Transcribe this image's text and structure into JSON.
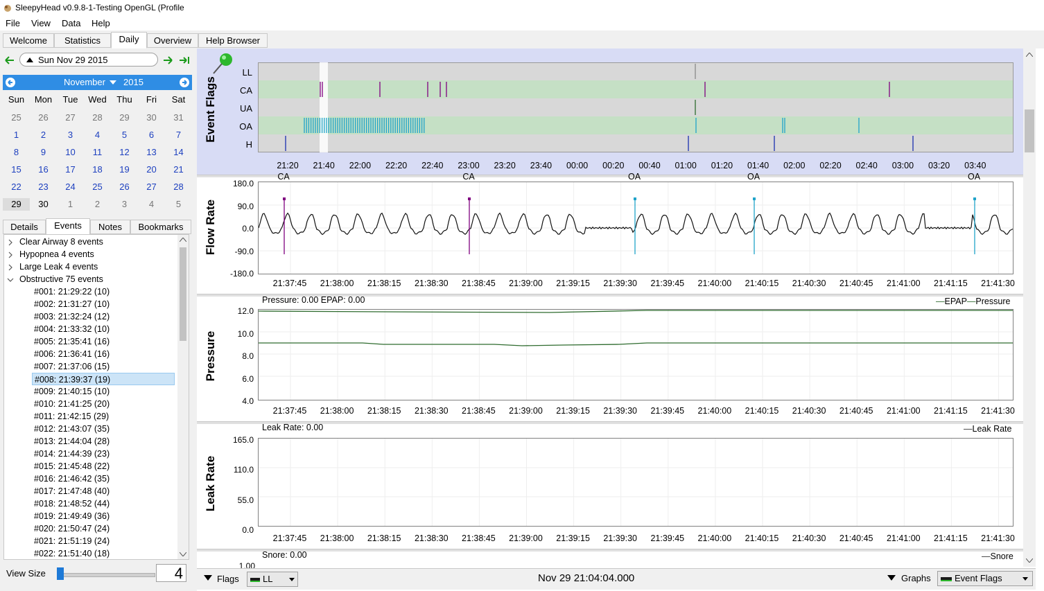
{
  "window": {
    "title": "SleepyHead v0.9.8-1-Testing OpenGL (Profile"
  },
  "menu": [
    "File",
    "View",
    "Data",
    "Help"
  ],
  "tabs": [
    {
      "label": "Welcome"
    },
    {
      "label": "Statistics"
    },
    {
      "label": "Daily"
    },
    {
      "label": "Overview"
    },
    {
      "label": "Help Browser"
    }
  ],
  "date_nav": {
    "current_date": "Sun Nov 29 2015"
  },
  "calendar": {
    "month": "November",
    "year": "2015",
    "weekdays": [
      "Sun",
      "Mon",
      "Tue",
      "Wed",
      "Thu",
      "Fri",
      "Sat"
    ],
    "weeks": [
      [
        "25",
        "26",
        "27",
        "28",
        "29",
        "30",
        "31"
      ],
      [
        "1",
        "2",
        "3",
        "4",
        "5",
        "6",
        "7"
      ],
      [
        "8",
        "9",
        "10",
        "11",
        "12",
        "13",
        "14"
      ],
      [
        "15",
        "16",
        "17",
        "18",
        "19",
        "20",
        "21"
      ],
      [
        "22",
        "23",
        "24",
        "25",
        "26",
        "27",
        "28"
      ],
      [
        "29",
        "30",
        "1",
        "2",
        "3",
        "4",
        "5"
      ]
    ],
    "selected": "29"
  },
  "left_tabs": [
    "Details",
    "Events",
    "Notes",
    "Bookmarks"
  ],
  "event_tree": {
    "groups": [
      "Clear Airway 8 events",
      "Hypopnea 4 events",
      "Large Leak 4 events",
      "Obstructive 75 events"
    ],
    "items": [
      "#001: 21:29:22 (10)",
      "#002: 21:31:27 (10)",
      "#003: 21:32:24 (12)",
      "#004: 21:33:32 (10)",
      "#005: 21:35:41 (16)",
      "#006: 21:36:41 (16)",
      "#007: 21:37:06 (15)",
      "#008: 21:39:37 (19)",
      "#009: 21:40:15 (10)",
      "#010: 21:41:25 (20)",
      "#011: 21:42:15 (29)",
      "#012: 21:43:07 (35)",
      "#013: 21:44:04 (28)",
      "#014: 21:44:39 (23)",
      "#015: 21:45:48 (22)",
      "#016: 21:46:42 (35)",
      "#017: 21:47:48 (40)",
      "#018: 21:48:52 (44)",
      "#019: 21:49:49 (36)",
      "#020: 21:50:47 (24)",
      "#021: 21:51:19 (24)",
      "#022: 21:51:40 (18)"
    ],
    "selected_index": 7
  },
  "view_size": {
    "label": "View Size",
    "value": "4"
  },
  "event_flags": {
    "title": "Event Flags",
    "rows": [
      "LL",
      "CA",
      "UA",
      "OA",
      "H"
    ],
    "time_ticks": [
      "21:20",
      "21:40",
      "22:00",
      "22:20",
      "22:40",
      "23:00",
      "23:20",
      "23:40",
      "00:00",
      "00:20",
      "00:40",
      "01:00",
      "01:20",
      "01:40",
      "02:00",
      "02:20",
      "02:40",
      "03:00",
      "03:20",
      "03:40"
    ]
  },
  "flow_rate": {
    "title": "Flow Rate",
    "yticks": [
      "180.0",
      "90.0",
      "0.0",
      "-90.0",
      "-180.0"
    ],
    "events": [
      {
        "label": "CA"
      },
      {
        "label": "CA"
      },
      {
        "label": "OA"
      },
      {
        "label": "OA"
      },
      {
        "label": "OA"
      }
    ],
    "xticks": [
      "21:37:45",
      "21:38:00",
      "21:38:15",
      "21:38:30",
      "21:38:45",
      "21:39:00",
      "21:39:15",
      "21:39:30",
      "21:39:45",
      "21:40:00",
      "21:40:15",
      "21:40:30",
      "21:40:45",
      "21:41:00",
      "21:41:15",
      "21:41:30"
    ]
  },
  "pressure": {
    "title": "Pressure",
    "info": "Pressure: 0.00 EPAP: 0.00",
    "legend": [
      "EPAP",
      "Pressure"
    ],
    "yticks": [
      "12.0",
      "10.0",
      "8.0",
      "6.0",
      "4.0"
    ],
    "xticks": [
      "21:37:45",
      "21:38:00",
      "21:38:15",
      "21:38:30",
      "21:38:45",
      "21:39:00",
      "21:39:15",
      "21:39:30",
      "21:39:45",
      "21:40:00",
      "21:40:15",
      "21:40:30",
      "21:40:45",
      "21:41:00",
      "21:41:15",
      "21:41:30"
    ]
  },
  "leak_rate": {
    "title": "Leak Rate",
    "info": "Leak Rate: 0.00",
    "legend": [
      "Leak Rate"
    ],
    "yticks": [
      "165.0",
      "110.0",
      "55.0",
      "0.0"
    ],
    "xticks": [
      "21:37:45",
      "21:38:00",
      "21:38:15",
      "21:38:30",
      "21:38:45",
      "21:39:00",
      "21:39:15",
      "21:39:30",
      "21:39:45",
      "21:40:00",
      "21:40:15",
      "21:40:30",
      "21:40:45",
      "21:41:00",
      "21:41:15",
      "21:41:30"
    ]
  },
  "snore": {
    "info": "Snore: 0.00",
    "legend": [
      "Snore"
    ],
    "ytick_partial": "1.00"
  },
  "bottom_bar": {
    "flags_label": "Flags",
    "flags_select": "LL",
    "timestamp": "Nov 29 21:04:04.000",
    "graphs_label": "Graphs",
    "graphs_select": "Event Flags"
  },
  "colors": {
    "accent": "#2f8de4",
    "flag_band": "#c5e0c5",
    "flag_bg": "#d8d8d8",
    "ca": "#800080",
    "oa": "#1fa3c9",
    "h": "#1a2fb0",
    "ll": "#888888",
    "pressure_line": "#2e6b2e"
  }
}
